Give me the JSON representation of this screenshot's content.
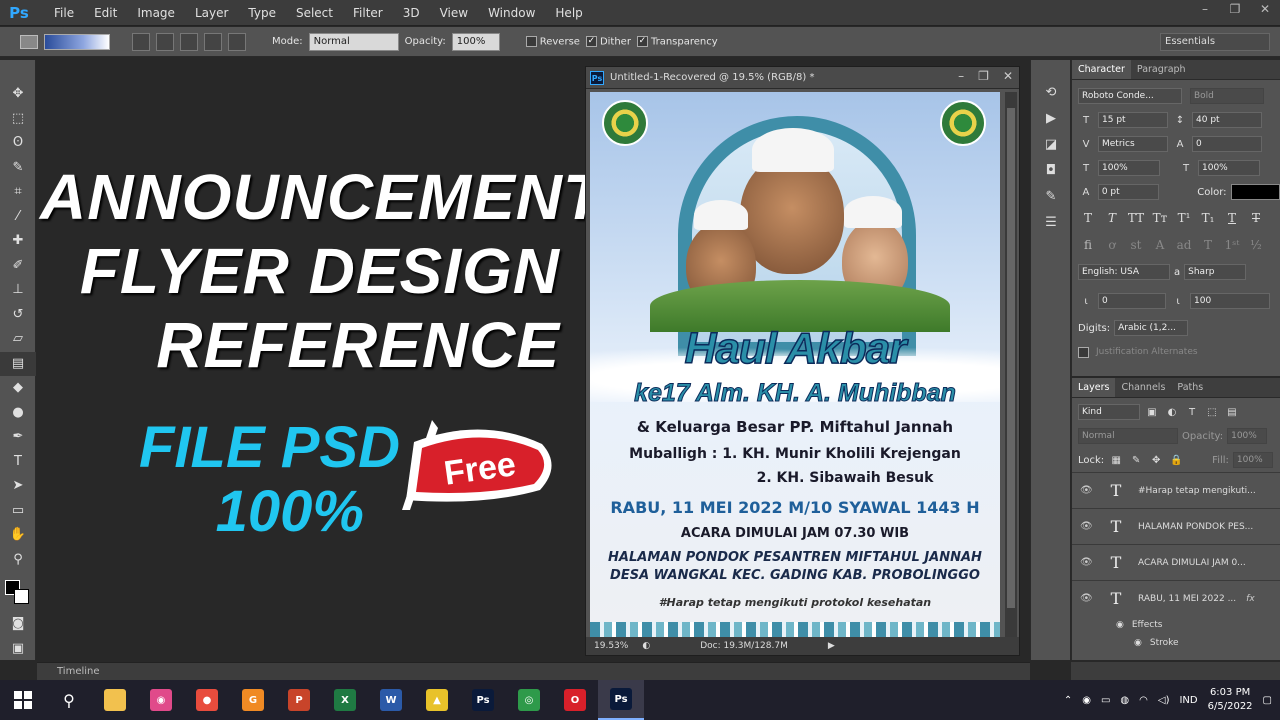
{
  "app": {
    "logo": "Ps"
  },
  "menu": [
    "File",
    "Edit",
    "Image",
    "Layer",
    "Type",
    "Select",
    "Filter",
    "3D",
    "View",
    "Window",
    "Help"
  ],
  "window_controls": [
    "–",
    "❐",
    "✕"
  ],
  "options": {
    "mode_label": "Mode:",
    "mode_value": "Normal",
    "opacity_label": "Opacity:",
    "opacity_value": "100%",
    "reverse": "Reverse",
    "dither": "Dither",
    "transparency": "Transparency",
    "workspace": "Essentials"
  },
  "thumbnail": {
    "headline": [
      "ANNOUNCEMENT",
      "FLYER DESIGN",
      "REFERENCE"
    ],
    "file_psd": "FILE PSD",
    "percent": "100%",
    "badge": "Free"
  },
  "document": {
    "title": "Untitled-1-Recovered @ 19.5% (RGB/8) *",
    "zoom": "19.53%",
    "doc_size": "Doc: 19.3M/128.7M"
  },
  "flyer": {
    "title": "Haul Akbar",
    "subtitle": "ke17 Alm. KH. A. Muhibban",
    "family": "& Keluarga Besar PP. Miftahul Jannah",
    "muballigh1": "Muballigh : 1. KH. Munir Kholili Krejengan",
    "muballigh2": "2. KH. Sibawaih Besuk",
    "date": "RABU, 11 MEI 2022 M/10 SYAWAL 1443 H",
    "time": "ACARA DIMULAI JAM 07.30 WIB",
    "venue1": "HALAMAN PONDOK PESANTREN MIFTAHUL JANNAH",
    "venue2": "DESA WANGKAL KEC. GADING KAB. PROBOLINGGO",
    "note": "#Harap tetap mengikuti protokol kesehatan"
  },
  "character_panel": {
    "tabs": [
      "Character",
      "Paragraph"
    ],
    "font_family": "Roboto Conde...",
    "font_style": "Bold",
    "font_size": "15 pt",
    "leading": "40 pt",
    "kerning": "Metrics",
    "tracking": "0",
    "vscale": "100%",
    "hscale": "100%",
    "baseline": "0 pt",
    "color_label": "Color:",
    "language": "English: USA",
    "aa_label": "a",
    "antialias": "Sharp",
    "indent1": "0",
    "indent2": "100",
    "digits_label": "Digits:",
    "digits": "Arabic (1,2...",
    "justification": "Justification Alternates",
    "text_color": "#000000"
  },
  "layers_panel": {
    "tabs": [
      "Layers",
      "Channels",
      "Paths"
    ],
    "kind": "Kind",
    "blend": "Normal",
    "opacity_label": "Opacity:",
    "opacity": "100%",
    "lock_label": "Lock:",
    "fill_label": "Fill:",
    "fill": "100%",
    "layers": [
      {
        "name": "#Harap tetap mengikuti..."
      },
      {
        "name": "HALAMAN PONDOK PES..."
      },
      {
        "name": "ACARA DIMULAI JAM 0..."
      },
      {
        "name": "RABU, 11 MEI 2022 ..."
      }
    ],
    "fx": "fx",
    "effects_label": "Effects",
    "stroke_label": "Stroke"
  },
  "timeline": "Timeline",
  "taskbar": {
    "lang": "IND",
    "time": "6:03 PM",
    "date": "6/5/2022",
    "apps": [
      {
        "name": "file-explorer-icon",
        "glyph": "",
        "color": "#f2c14e"
      },
      {
        "name": "photos-icon",
        "glyph": "◉",
        "color": "#e04a8a"
      },
      {
        "name": "screen-recorder-icon",
        "glyph": "●",
        "color": "#e84c3d"
      },
      {
        "name": "tool-icon",
        "glyph": "G",
        "color": "#f08a24"
      },
      {
        "name": "powerpoint-icon",
        "glyph": "P",
        "color": "#c8442a"
      },
      {
        "name": "excel-icon",
        "glyph": "X",
        "color": "#1f7a43"
      },
      {
        "name": "word-icon",
        "glyph": "W",
        "color": "#2b5aa8"
      },
      {
        "name": "warning-app-icon",
        "glyph": "▲",
        "color": "#e8c22a"
      },
      {
        "name": "photoshop-icon",
        "glyph": "Ps",
        "color": "#0a1a3a"
      },
      {
        "name": "chrome-icon",
        "glyph": "◎",
        "color": "#2e9a4a"
      },
      {
        "name": "opera-icon",
        "glyph": "O",
        "color": "#d8202a"
      },
      {
        "name": "photoshop-active-icon",
        "glyph": "Ps",
        "color": "#0a1a3a"
      }
    ]
  }
}
